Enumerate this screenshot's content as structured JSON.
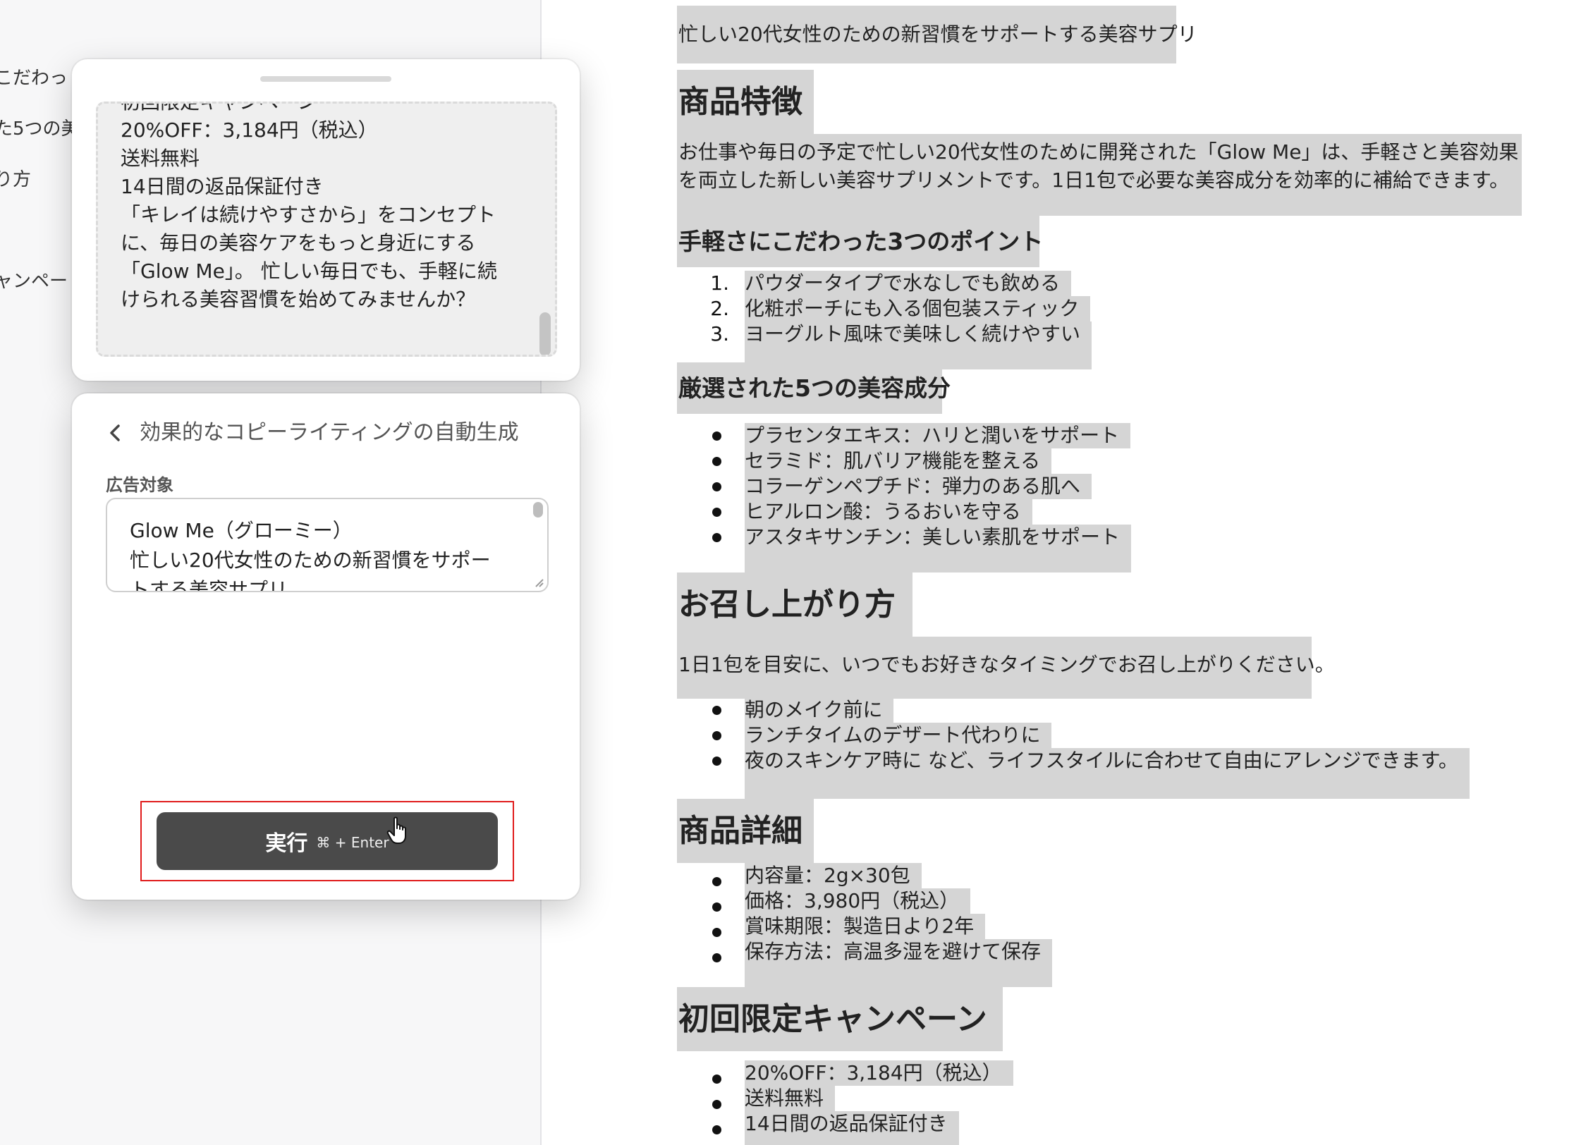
{
  "sidebar": {
    "items": [
      "こだわっ",
      "た5つの美",
      "り方",
      "ャンペー"
    ]
  },
  "document": {
    "intro": "忙しい20代女性のための新習慣をサポートする美容サプリ",
    "features_heading": "商品特徴",
    "features_body": "お仕事や毎日の予定で忙しい20代女性のために開発された「Glow Me」は、手軽さと美容効果を両立した新しい美容サプリメントです。1日1包で必要な美容成分を効率的に補給できます。",
    "points_heading": "手軽さにこだわった3つのポイント",
    "points": [
      "パウダータイプで水なしでも飲める",
      "化粧ポーチにも入る個包装スティック",
      "ヨーグルト風味で美味しく続けやすい"
    ],
    "ingredients_heading": "厳選された5つの美容成分",
    "ingredients": [
      "プラセンタエキス：ハリと潤いをサポート",
      "セラミド：肌バリア機能を整える",
      "コラーゲンペプチド：弾力のある肌へ",
      "ヒアルロン酸：うるおいを守る",
      "アスタキサンチン：美しい素肌をサポート"
    ],
    "howto_heading": "お召し上がり方",
    "howto_body": "1日1包を目安に、いつでもお好きなタイミングでお召し上がりください。",
    "howto_list": [
      "朝のメイク前に",
      "ランチタイムのデザート代わりに",
      "夜のスキンケア時に など、ライフスタイルに合わせて自由にアレンジできます。"
    ],
    "details_heading": "商品詳細",
    "details": [
      "内容量：2g×30包",
      "価格：3,980円（税込）",
      "賞味期限：製造日より2年",
      "保存方法：高温多湿を避けて保存"
    ],
    "campaign_heading": "初回限定キャンペーン",
    "campaign": [
      "20%OFF：3,184円（税込）",
      "送料無料",
      "14日間の返品保証付き"
    ]
  },
  "result_panel": {
    "lines": [
      "初回限定キャンペーン",
      "20%OFF：3,184円（税込）",
      "送料無料",
      "14日間の返品保証付き",
      "「キレイは続けやすさから」をコンセプト",
      "に、毎日の美容ケアをもっと身近にする",
      "「Glow Me」。 忙しい毎日でも、手軽に続",
      "けられる美容習慣を始めてみませんか？"
    ]
  },
  "tool_panel": {
    "title": "効果的なコピーライティングの自動生成",
    "field_label": "広告対象",
    "input_lines": [
      "Glow Me（グローミー）",
      "忙しい20代女性のための新習慣をサポー",
      "トする美容サプリ"
    ],
    "run_label": "実行",
    "run_shortcut": "⌘ + Enter"
  },
  "icons": {
    "back": "chevron-left-icon",
    "cursor": "hand-pointer-icon"
  }
}
